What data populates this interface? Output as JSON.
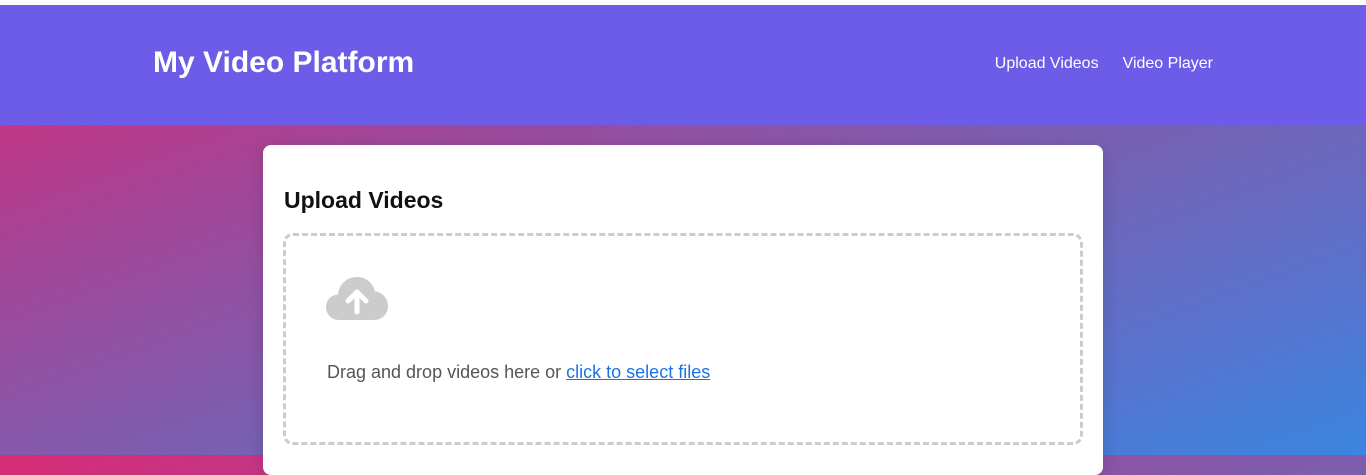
{
  "header": {
    "title": "My Video Platform",
    "nav": [
      {
        "label": "Upload Videos"
      },
      {
        "label": "Video Player"
      }
    ],
    "background": "#6c5ce7"
  },
  "upload": {
    "title": "Upload Videos",
    "dropzone": {
      "icon": "cloud-upload-icon",
      "text": "Drag and drop videos here or ",
      "link": "click to select files"
    }
  },
  "colors": {
    "accent": "#6c5ce7",
    "link": "#1a73e8",
    "gradient_start": "#d92b76",
    "gradient_end": "#3a86e0"
  }
}
